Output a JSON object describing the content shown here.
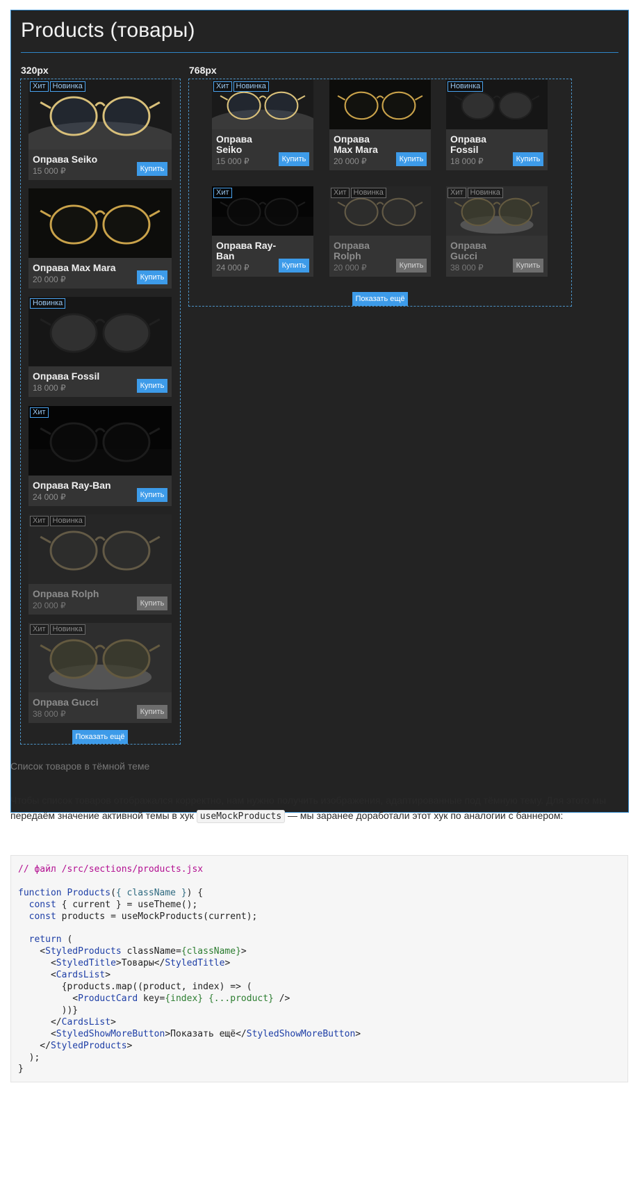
{
  "figure": {
    "title": "Products (товары)",
    "bp_small": "320px",
    "bp_large": "768px",
    "show_more": "Показать ещё"
  },
  "products": [
    {
      "name": "Оправа Seiko",
      "name_l1": "Оправа",
      "name_l2": "Seiko",
      "price": "15 000 ₽",
      "badges": [
        "Хит",
        "Новинка"
      ],
      "buy": "Купить",
      "available": true
    },
    {
      "name": "Оправа Max Mara",
      "name_l1": "Оправа",
      "name_l2": "Max Mara",
      "price": "20 000 ₽",
      "badges": [],
      "buy": "Купить",
      "available": true
    },
    {
      "name": "Оправа Fossil",
      "name_l1": "Оправа",
      "name_l2": "Fossil",
      "price": "18 000 ₽",
      "badges": [
        "Новинка"
      ],
      "buy": "Купить",
      "available": true
    },
    {
      "name": "Оправа Ray-Ban",
      "name_l1": "Оправа Ray-",
      "name_l2": "Ban",
      "price": "24 000 ₽",
      "badges": [
        "Хит"
      ],
      "buy": "Купить",
      "available": true
    },
    {
      "name": "Оправа Rolph",
      "name_l1": "Оправа",
      "name_l2": "Rolph",
      "price": "20 000 ₽",
      "badges": [
        "Хит",
        "Новинка"
      ],
      "buy": "Купить",
      "available": false
    },
    {
      "name": "Оправа Gucci",
      "name_l1": "Оправа",
      "name_l2": "Gucci",
      "price": "38 000 ₽",
      "badges": [
        "Хит",
        "Новинка"
      ],
      "buy": "Купить",
      "available": false
    }
  ],
  "caption": "Список товаров в тёмной теме",
  "paragraph": {
    "part1": "Чтобы список товаров отображался корректно, нам нужно получить изображения, адаптированные под тёмную тему. Для этого мы передаём значение активной темы в хук ",
    "code": "useMockProducts",
    "part2": " — мы заранее доработали этот хук по аналогии с баннером:"
  },
  "code_lines": [
    "// файл /src/sections/products.jsx",
    "",
    "function Products({ className }) {",
    "  const { current } = useTheme();",
    "  const products = useMockProducts(current);",
    "",
    "  return (",
    "    <StyledProducts className={className}>",
    "      <StyledTitle>Товары</StyledTitle>",
    "      <CardsList>",
    "        {products.map((product, index) => (",
    "          <ProductCard key={index} {...product} />",
    "        ))}",
    "      </CardsList>",
    "      <StyledShowMoreButton>Показать ещё</StyledShowMoreButton>",
    "    </StyledProducts>",
    "  );",
    "}"
  ]
}
